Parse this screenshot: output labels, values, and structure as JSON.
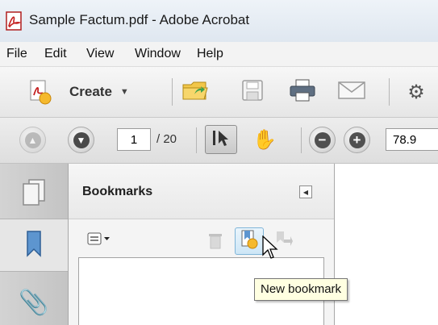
{
  "window": {
    "title": "Sample Factum.pdf - Adobe Acrobat"
  },
  "menu": [
    "File",
    "Edit",
    "View",
    "Window",
    "Help"
  ],
  "toolbar": {
    "create_label": "Create"
  },
  "nav": {
    "page_value": "1",
    "page_total": "/ 20",
    "zoom_value": "78.9"
  },
  "bookmarks_panel": {
    "title": "Bookmarks"
  },
  "tooltip": {
    "text": "New bookmark"
  },
  "icons": {
    "app": "acrobat-icon",
    "create": "create-pdf-icon",
    "open": "open-folder-icon",
    "save": "save-icon",
    "print": "print-icon",
    "email": "email-icon",
    "settings": "gear-icon",
    "prev_page": "arrow-up-icon",
    "next_page": "arrow-down-icon",
    "select": "select-cursor-icon",
    "hand": "hand-tool-icon",
    "zoom_out": "zoom-out-icon",
    "zoom_in": "zoom-in-icon",
    "pages_panel": "pages-panel-icon",
    "bookmarks_panel": "bookmark-ribbon-icon",
    "attachments_panel": "paperclip-icon",
    "options": "bookmark-options-icon",
    "delete": "trash-icon",
    "new_bookmark": "new-bookmark-icon",
    "expand": "expand-bookmark-icon",
    "collapse_panel": "collapse-panel-icon"
  }
}
